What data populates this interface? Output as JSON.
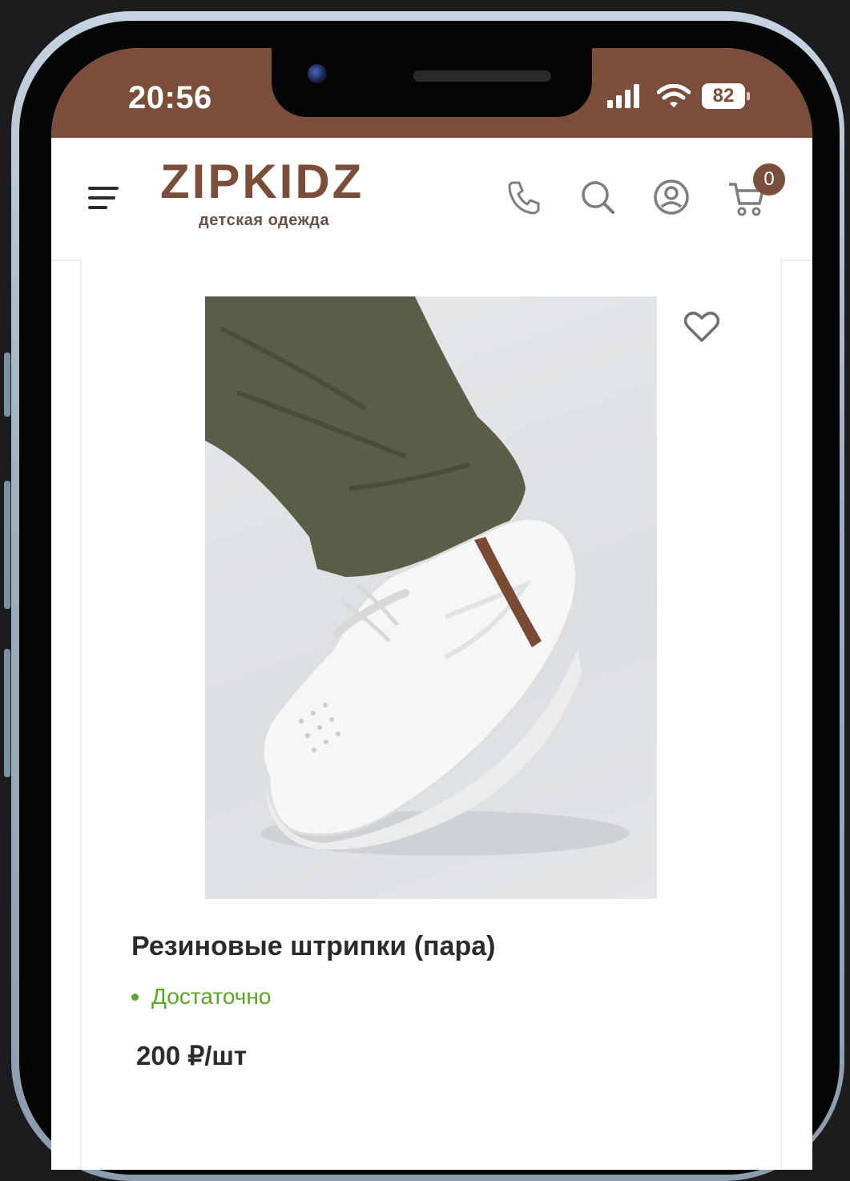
{
  "status_bar": {
    "time": "20:56",
    "battery": "82",
    "icons": [
      "signal-icon",
      "wifi-icon",
      "battery-icon"
    ]
  },
  "header": {
    "logo_title": "ZIPKIDZ",
    "logo_subtitle": "детская одежда",
    "cart_count": "0",
    "icons": [
      "menu-icon",
      "phone-icon",
      "search-icon",
      "account-icon",
      "cart-icon"
    ]
  },
  "product": {
    "title": "Резиновые штрипки (пара)",
    "stock_status": "Достаточно",
    "price": "200 ₽/шт",
    "image_alt": "white sneaker with brown strap"
  },
  "colors": {
    "brand": "#7a4e3b",
    "stock_green": "#5ba52c",
    "text": "#2b2b2b"
  }
}
